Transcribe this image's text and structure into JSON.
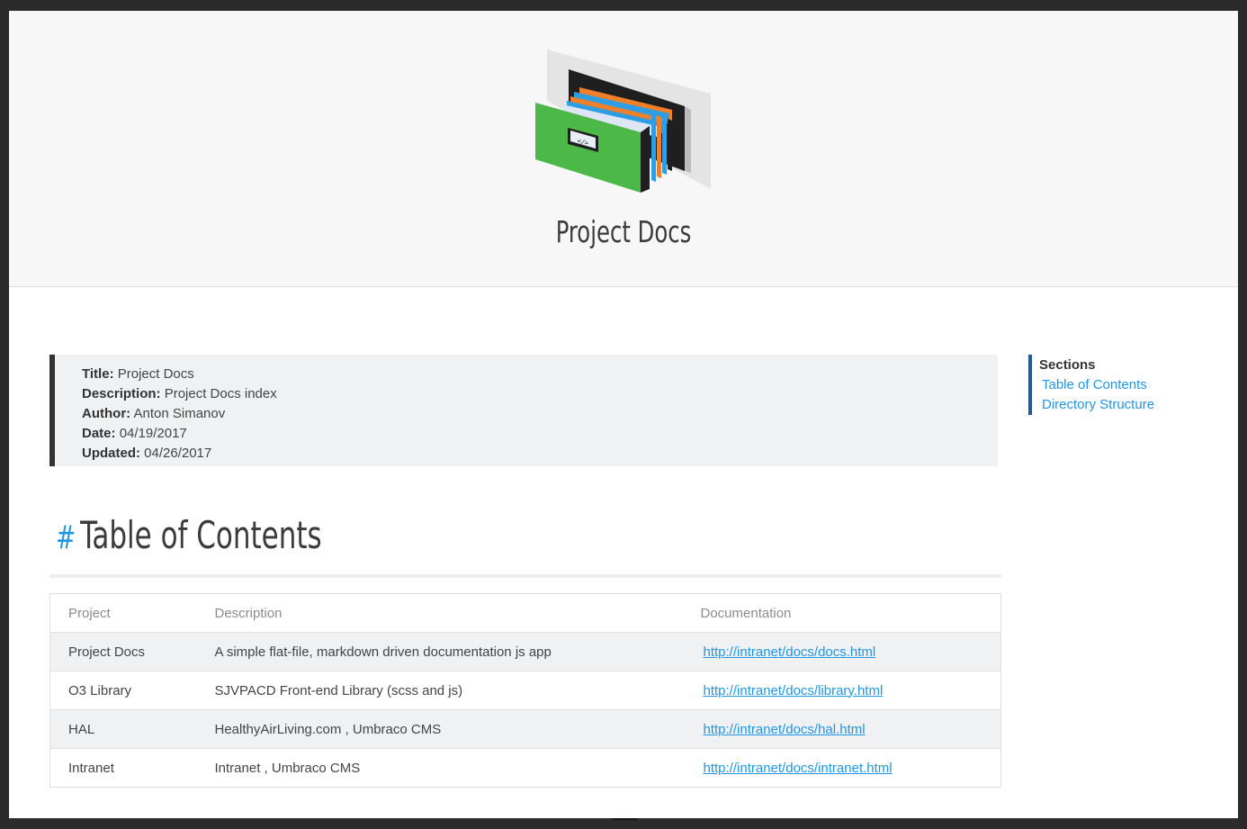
{
  "header": {
    "logo_icon": "file-cabinet-drawer-icon",
    "logo_label": "</>",
    "title": "Project Docs"
  },
  "meta": {
    "title_label": "Title:",
    "title_value": "Project Docs",
    "description_label": "Description:",
    "description_value": "Project Docs index",
    "author_label": "Author:",
    "author_value": "Anton Simanov",
    "date_label": "Date:",
    "date_value": "04/19/2017",
    "updated_label": "Updated:",
    "updated_value": "04/26/2017"
  },
  "toc": {
    "hash": "#",
    "heading": "Table of Contents",
    "columns": [
      "Project",
      "Description",
      "Documentation"
    ],
    "rows": [
      {
        "project": "Project Docs",
        "description": "A simple flat-file, markdown driven documentation js app",
        "link": "http://intranet/docs/docs.html"
      },
      {
        "project": "O3 Library",
        "description": "SJVPACD Front-end Library (scss and js)",
        "link": "http://intranet/docs/library.html"
      },
      {
        "project": "HAL",
        "description": "HealthyAirLiving.com , Umbraco CMS",
        "link": "http://intranet/docs/hal.html"
      },
      {
        "project": "Intranet",
        "description": "Intranet , Umbraco CMS",
        "link": "http://intranet/docs/intranet.html"
      }
    ]
  },
  "sidebar": {
    "title": "Sections",
    "links": [
      "Table of Contents",
      "Directory Structure"
    ]
  },
  "colors": {
    "accent": "#2196e6",
    "sidebar_bar": "#1e5a99",
    "drawer_green": "#4cb848",
    "folder_orange": "#f07f2a",
    "folder_blue": "#2e9de3"
  }
}
